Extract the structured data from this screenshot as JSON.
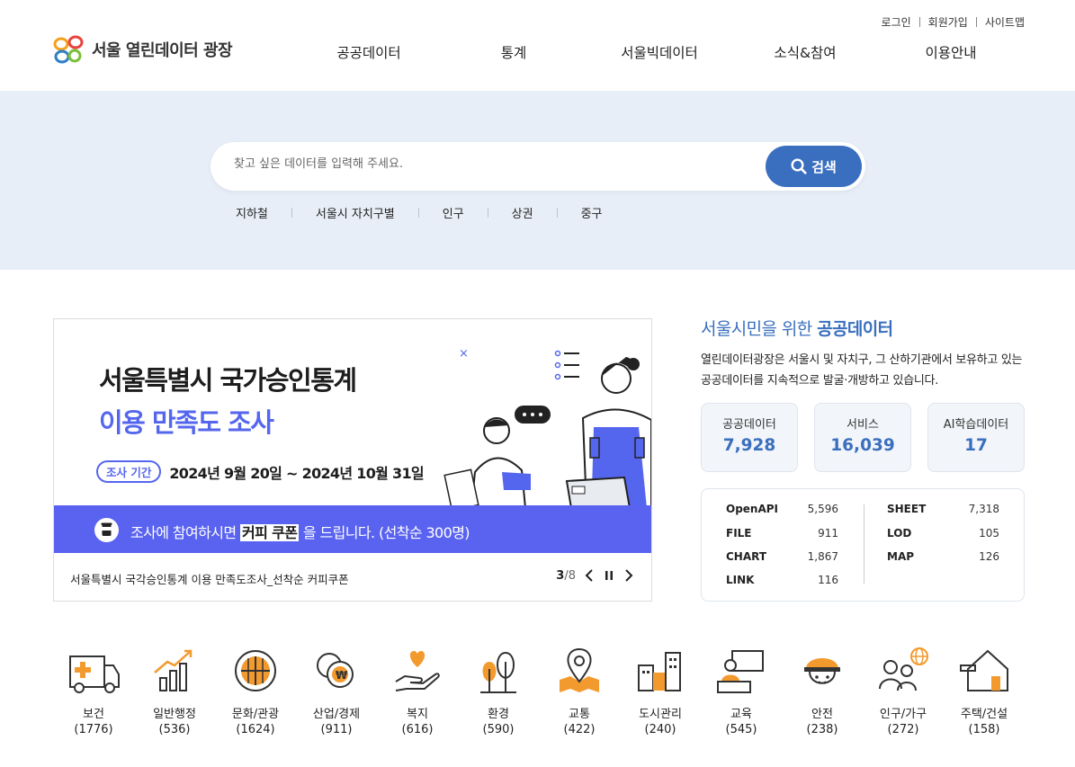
{
  "header": {
    "util_links": [
      "로그인",
      "회원가입",
      "사이트맵"
    ],
    "logo_text": "서울 열린데이터 광장",
    "nav": [
      "공공데이터",
      "통계",
      "서울빅데이터",
      "소식&참여",
      "이용안내"
    ]
  },
  "search": {
    "placeholder": "찾고 싶은 데이터를 입력해 주세요.",
    "button": "검색",
    "keywords": [
      "지하철",
      "서울시 자치구별",
      "인구",
      "상권",
      "중구"
    ]
  },
  "banner": {
    "title_line1": "서울특별시 국가승인통계",
    "title_line2": "이용 만족도 조사",
    "period_tag": "조사 기간",
    "period": "2024년 9월 20일 ~ 2024년 10월 31일",
    "strip_pre": "조사에 참여하시면",
    "strip_highlight": "커피 쿠폰",
    "strip_post": "을 드립니다. (선착순 300명)",
    "caption": "서울특별시 국각승인통계 이용 만족도조사_선착순 커피쿠폰",
    "page_current": "3",
    "page_total": "/8"
  },
  "info": {
    "title_pre": "서울시민을 위한",
    "title_bold": "공공데이터",
    "desc": "열린데이터광장은 서울시 및 자치구, 그 산하기관에서 보유하고 있는 공공데이터를 지속적으로 발굴·개방하고 있습니다.",
    "stats": [
      {
        "label": "공공데이터",
        "value": "7,928"
      },
      {
        "label": "서비스",
        "value": "16,039"
      },
      {
        "label": "AI학습데이터",
        "value": "17"
      }
    ],
    "formats_left": [
      {
        "k": "OpenAPI",
        "v": "5,596"
      },
      {
        "k": "FILE",
        "v": "911"
      },
      {
        "k": "CHART",
        "v": "1,867"
      },
      {
        "k": "LINK",
        "v": "116"
      }
    ],
    "formats_right": [
      {
        "k": "SHEET",
        "v": "7,318"
      },
      {
        "k": "LOD",
        "v": "105"
      },
      {
        "k": "MAP",
        "v": "126"
      }
    ]
  },
  "categories": [
    {
      "name": "보건",
      "count": "(1776)",
      "icon": "ambulance-icon"
    },
    {
      "name": "일반행정",
      "count": "(536)",
      "icon": "bar-growth-icon"
    },
    {
      "name": "문화/관광",
      "count": "(1624)",
      "icon": "window-icon"
    },
    {
      "name": "산업/경제",
      "count": "(911)",
      "icon": "coins-icon"
    },
    {
      "name": "복지",
      "count": "(616)",
      "icon": "hand-heart-icon"
    },
    {
      "name": "환경",
      "count": "(590)",
      "icon": "trees-icon"
    },
    {
      "name": "교통",
      "count": "(422)",
      "icon": "map-pin-icon"
    },
    {
      "name": "도시관리",
      "count": "(240)",
      "icon": "buildings-icon"
    },
    {
      "name": "교육",
      "count": "(545)",
      "icon": "teacher-icon"
    },
    {
      "name": "안전",
      "count": "(238)",
      "icon": "helmet-icon"
    },
    {
      "name": "인구/가구",
      "count": "(272)",
      "icon": "people-globe-icon"
    },
    {
      "name": "주택/건설",
      "count": "(158)",
      "icon": "house-build-icon"
    }
  ],
  "colors": {
    "brand_blue": "#3a6fbf",
    "banner_purple": "#5a63f0",
    "hero_bg": "#e8eef7",
    "icon_orange": "#f39a2e"
  }
}
